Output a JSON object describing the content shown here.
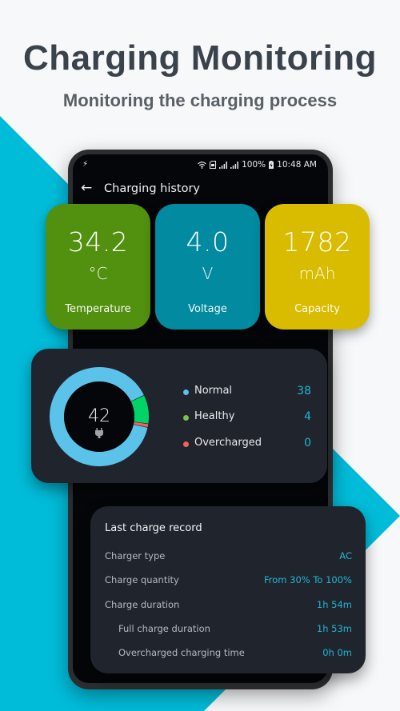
{
  "hero": {
    "title": "Charging Monitoring",
    "subtitle": "Monitoring the charging process"
  },
  "colors": {
    "accent_cyan": "#00bcd9",
    "temperature_tile": "#52900f",
    "voltage_tile": "#028aa0",
    "capacity_tile": "#d9bc00",
    "value_text": "#1fb6d2",
    "normal": "#5bc2ea",
    "healthy": "#00d468",
    "overcharged": "#f0625a",
    "legend_healthy_dot": "#7dc242"
  },
  "statusbar": {
    "left_icon": "charging-bolt-icon",
    "icons": [
      "wifi-icon",
      "sim-icon",
      "signal-icon",
      "signal-icon"
    ],
    "battery_percent": "100%",
    "battery_icon": "battery-charging-icon",
    "time": "10:48 AM"
  },
  "appbar": {
    "back_icon": "back-arrow-icon",
    "title": "Charging history"
  },
  "tiles": [
    {
      "value": "34.2",
      "unit": "°C",
      "label": "Temperature"
    },
    {
      "value": "4.0",
      "unit": "V",
      "label": "Voltage"
    },
    {
      "value": "1782",
      "unit": "mAh",
      "label": "Capacity"
    }
  ],
  "stats": {
    "total": "42",
    "center_icon": "plug-icon",
    "legend": [
      {
        "label": "Normal",
        "value": "38"
      },
      {
        "label": "Healthy",
        "value": "4"
      },
      {
        "label": "Overcharged",
        "value": "0"
      }
    ]
  },
  "chart_data": {
    "type": "pie",
    "title": "",
    "categories": [
      "Normal",
      "Healthy",
      "Overcharged"
    ],
    "values": [
      38,
      4,
      0
    ],
    "total": 42,
    "legend": "right"
  },
  "record": {
    "title": "Last charge record",
    "rows": [
      {
        "label": "Charger type",
        "value": "AC"
      },
      {
        "label": "Charge quantity",
        "value": "From 30% To 100%"
      },
      {
        "label": "Charge duration",
        "value": "1h 54m"
      },
      {
        "label": "Full charge duration",
        "value": "1h 53m"
      },
      {
        "label": "Overcharged charging time",
        "value": "0h 0m"
      }
    ]
  }
}
